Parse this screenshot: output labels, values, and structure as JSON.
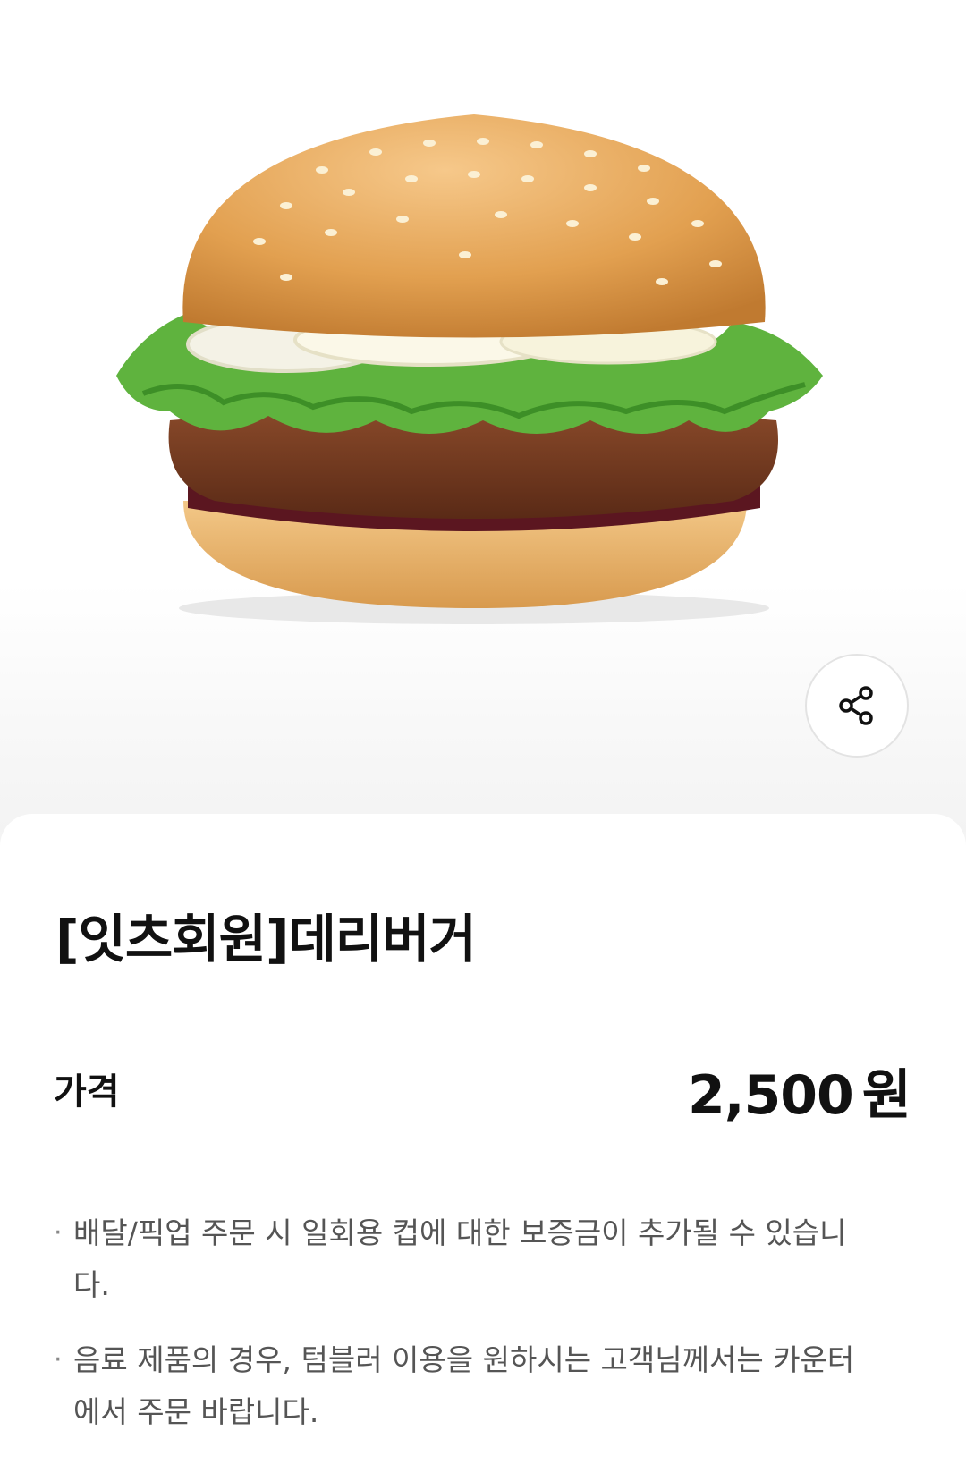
{
  "product": {
    "image_icon": "burger-image",
    "title": "[잇츠회원]데리버거"
  },
  "share": {
    "icon": "share-icon"
  },
  "price": {
    "label": "가격",
    "amount": "2,500",
    "unit": "원"
  },
  "notices": [
    {
      "bullet": "·",
      "text": "배달/픽업 주문 시 일회용 컵에 대한 보증금이 추가될 수 있습니다."
    },
    {
      "bullet": "·",
      "text": "음료 제품의 경우, 텀블러 이용을 원하시는 고객님께서는 카운터에서 주문 바랍니다."
    }
  ],
  "colors": {
    "text": "#111111",
    "muted": "#555555",
    "background": "#f4f4f4",
    "sheet": "#ffffff"
  }
}
